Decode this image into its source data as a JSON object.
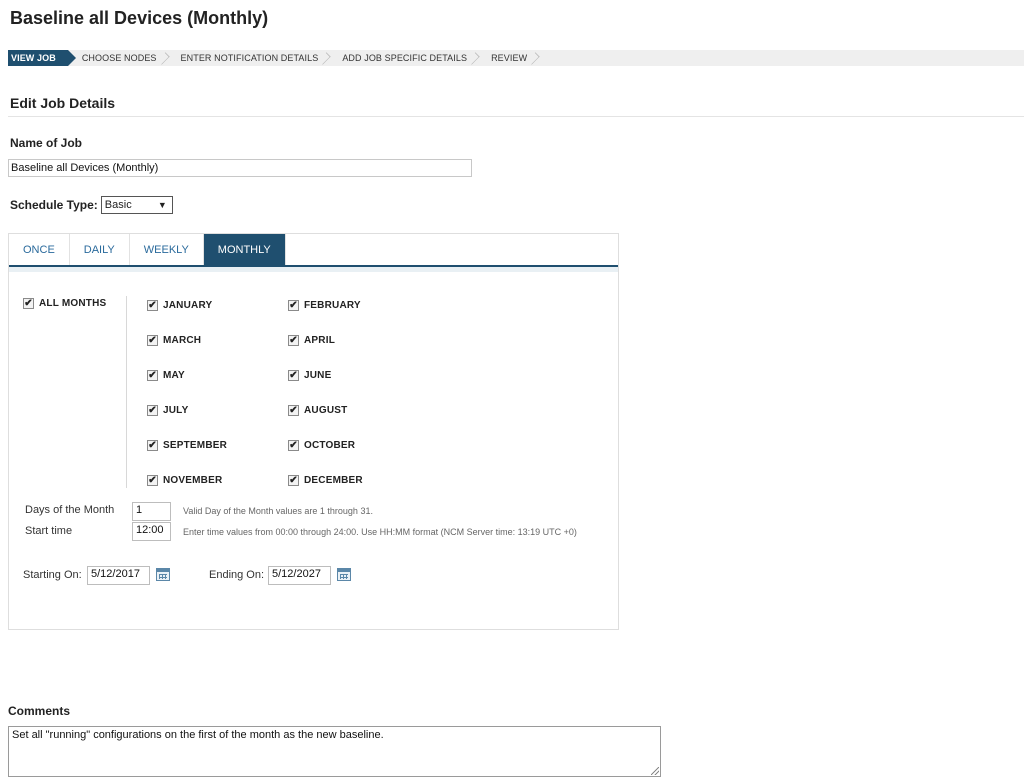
{
  "page": {
    "title": "Baseline all Devices (Monthly)"
  },
  "wizard": {
    "steps": [
      "VIEW JOB",
      "CHOOSE NODES",
      "ENTER NOTIFICATION DETAILS",
      "ADD JOB SPECIFIC DETAILS",
      "REVIEW"
    ],
    "active_step": "VIEW JOB"
  },
  "section": {
    "title": "Edit Job Details"
  },
  "job": {
    "name_label": "Name of Job",
    "name_value": "Baseline all Devices (Monthly)",
    "schedule_label": "Schedule Type:",
    "schedule_value": "Basic"
  },
  "schedule": {
    "tabs": [
      "ONCE",
      "DAILY",
      "WEEKLY",
      "MONTHLY"
    ],
    "active_tab": "MONTHLY",
    "all_months": {
      "label": "ALL MONTHS",
      "checked": true
    },
    "months": [
      {
        "label": "JANUARY",
        "checked": true
      },
      {
        "label": "FEBRUARY",
        "checked": true
      },
      {
        "label": "MARCH",
        "checked": true
      },
      {
        "label": "APRIL",
        "checked": true
      },
      {
        "label": "MAY",
        "checked": true
      },
      {
        "label": "JUNE",
        "checked": true
      },
      {
        "label": "JULY",
        "checked": true
      },
      {
        "label": "AUGUST",
        "checked": true
      },
      {
        "label": "SEPTEMBER",
        "checked": true
      },
      {
        "label": "OCTOBER",
        "checked": true
      },
      {
        "label": "NOVEMBER",
        "checked": true
      },
      {
        "label": "DECEMBER",
        "checked": true
      }
    ],
    "days_label": "Days of the Month",
    "days_value": "1",
    "days_hint": "Valid Day of the Month values are 1 through 31.",
    "start_label": "Start time",
    "start_value": "12:00",
    "start_hint": "Enter time values from 00:00 through 24:00. Use HH:MM format (NCM Server time: 13:19 UTC +0)",
    "starting_label": "Starting On:",
    "starting_value": "5/12/2017",
    "ending_label": "Ending On:",
    "ending_value": "5/12/2027"
  },
  "comments": {
    "label": "Comments",
    "value": "Set all \"running\" configurations on the first of the month as the new baseline."
  },
  "colors": {
    "accent": "#1f4f6f",
    "tab_text": "#2a6a9c"
  }
}
